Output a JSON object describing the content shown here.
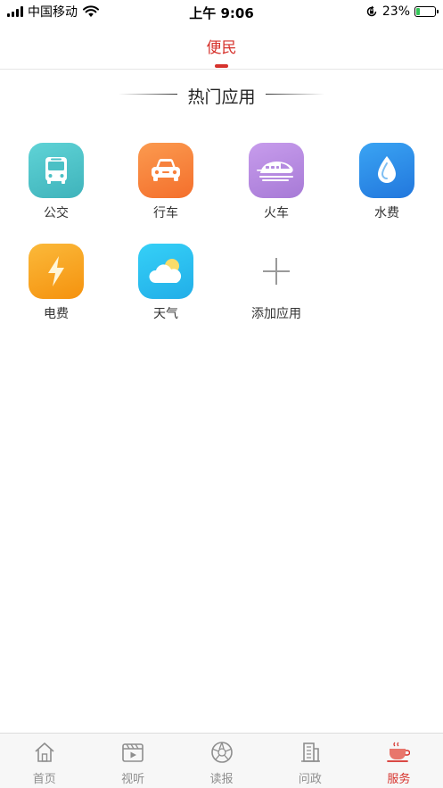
{
  "status_bar": {
    "carrier": "中国移动",
    "time": "上午 9:06",
    "battery_percent": "23%",
    "battery_level": 0.23,
    "icons": [
      "signal-icon",
      "wifi-icon",
      "orientation-lock-icon",
      "battery-icon"
    ]
  },
  "top_tab": {
    "label": "便民"
  },
  "section": {
    "title": "热门应用"
  },
  "apps": [
    {
      "label": "公交",
      "icon": "bus-icon",
      "color": "#4fc3c8"
    },
    {
      "label": "行车",
      "icon": "car-icon",
      "color": "#f7813d"
    },
    {
      "label": "火车",
      "icon": "train-icon",
      "color": "#b58be0"
    },
    {
      "label": "水费",
      "icon": "water-drop-icon",
      "color": "#2f8ee8"
    },
    {
      "label": "电费",
      "icon": "lightning-icon",
      "color": "#f8a41a"
    },
    {
      "label": "天气",
      "icon": "weather-cloud-sun-icon",
      "color": "#2fbff0"
    },
    {
      "label": "添加应用",
      "icon": "add-icon",
      "color": "#999999"
    }
  ],
  "bottom_nav": {
    "items": [
      {
        "label": "首页",
        "icon": "home-icon"
      },
      {
        "label": "视听",
        "icon": "video-icon"
      },
      {
        "label": "读报",
        "icon": "aperture-icon"
      },
      {
        "label": "问政",
        "icon": "building-icon"
      },
      {
        "label": "服务",
        "icon": "cup-icon",
        "active": true
      }
    ],
    "active_color": "#d6322c",
    "inactive_color": "#8e8e8e"
  },
  "colors": {
    "accent": "#d6322c"
  }
}
